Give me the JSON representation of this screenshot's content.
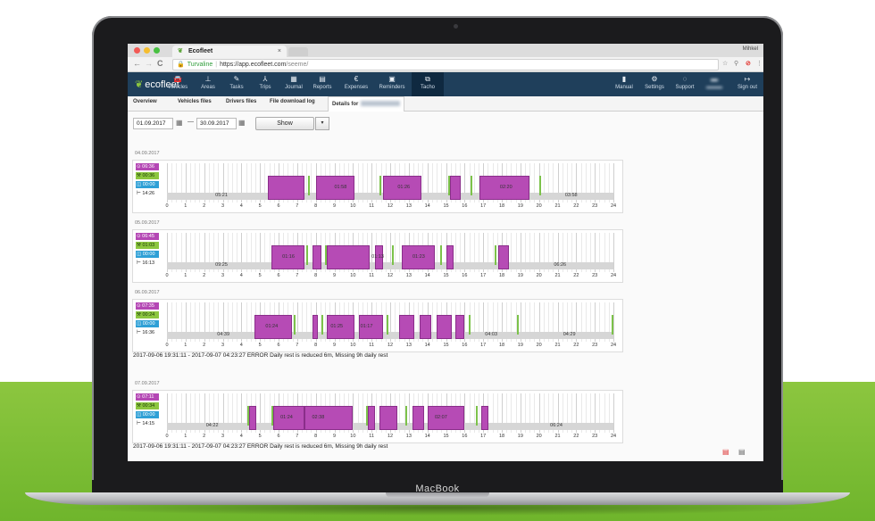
{
  "device": {
    "brand": "MacBook"
  },
  "browser": {
    "tab_title": "Ecofleet",
    "tab_close": "×",
    "user_name": "Mihkel",
    "url_org": "Turvaline",
    "url_host": "https://app.ecofleet.com",
    "url_path": "/seeme/",
    "back": "←",
    "forward": "→",
    "reload": "C"
  },
  "app": {
    "logo": "ecofleet",
    "nav": [
      {
        "icon": "🚘",
        "label": "Vehicles"
      },
      {
        "icon": "⊥",
        "label": "Areas"
      },
      {
        "icon": "✎",
        "label": "Tasks"
      },
      {
        "icon": "⅄",
        "label": "Trips"
      },
      {
        "icon": "▦",
        "label": "Journal"
      },
      {
        "icon": "▤",
        "label": "Reports"
      },
      {
        "icon": "€",
        "label": "Expenses"
      },
      {
        "icon": "▣",
        "label": "Reminders"
      },
      {
        "icon": "⧉",
        "label": "Tacho"
      }
    ],
    "right_nav": [
      {
        "icon": "▮",
        "label": "Manual"
      },
      {
        "icon": "⚙",
        "label": "Settings"
      },
      {
        "icon": "◌",
        "label": "Support"
      },
      {
        "icon": "↦",
        "label": "Sign out"
      }
    ],
    "subtabs": [
      "Overview",
      "Vehicles files",
      "Drivers files",
      "File download log",
      "Details for"
    ],
    "filter": {
      "from": "01.09.2017",
      "to": "30.09.2017",
      "separator": "—",
      "show_label": "Show",
      "caret": "▾"
    }
  },
  "days": [
    {
      "date": "04.09.2017",
      "totals": {
        "driving": "06:36",
        "work": "00:36",
        "available": "00:00",
        "rest": "14:26"
      },
      "rest_labels": [
        {
          "h": 2.6,
          "text": "05:21"
        },
        {
          "h": 21.4,
          "text": "03:58"
        }
      ],
      "drive_segments": [
        [
          5.4,
          7.4
        ],
        [
          8.0,
          10.1
        ],
        [
          11.6,
          13.7
        ],
        [
          15.2,
          15.8
        ],
        [
          16.8,
          19.5
        ]
      ],
      "drive_labels": [
        {
          "h": 9.0,
          "text": "01:58"
        },
        {
          "h": 12.4,
          "text": "01:26"
        },
        {
          "h": 17.9,
          "text": "02:20"
        }
      ],
      "work_ticks": [
        5.5,
        7.6,
        11.4,
        13.6,
        15.1,
        16.3,
        20.0
      ],
      "error": ""
    },
    {
      "date": "05.09.2017",
      "totals": {
        "driving": "06:45",
        "work": "01:03",
        "available": "00:00",
        "rest": "16:13"
      },
      "rest_labels": [
        {
          "h": 2.6,
          "text": "09:25"
        },
        {
          "h": 20.8,
          "text": "06:26"
        }
      ],
      "drive_segments": [
        [
          5.6,
          7.4
        ],
        [
          7.8,
          8.3
        ],
        [
          8.6,
          10.9
        ],
        [
          11.2,
          11.6
        ],
        [
          12.6,
          14.4
        ],
        [
          15.0,
          15.4
        ],
        [
          17.8,
          18.4
        ]
      ],
      "drive_labels": [
        {
          "h": 6.2,
          "text": "01:16"
        },
        {
          "h": 11.0,
          "text": "01:13"
        },
        {
          "h": 13.2,
          "text": "01:23"
        }
      ],
      "work_ticks": [
        6.9,
        7.5,
        8.5,
        9.8,
        10.8,
        12.1,
        14.7,
        17.6
      ],
      "error": ""
    },
    {
      "date": "06.09.2017",
      "totals": {
        "driving": "07:35",
        "work": "00:24",
        "available": "00:00",
        "rest": "16:36"
      },
      "rest_labels": [
        {
          "h": 2.7,
          "text": "04:39"
        },
        {
          "h": 17.1,
          "text": "04:03"
        },
        {
          "h": 21.3,
          "text": "04:29"
        }
      ],
      "drive_segments": [
        [
          4.7,
          6.7
        ],
        [
          7.8,
          8.1
        ],
        [
          8.6,
          10.1
        ],
        [
          10.3,
          11.6
        ],
        [
          12.5,
          13.3
        ],
        [
          13.6,
          14.2
        ],
        [
          14.5,
          15.3
        ],
        [
          15.5,
          16.0
        ]
      ],
      "drive_labels": [
        {
          "h": 5.3,
          "text": "01:24"
        },
        {
          "h": 8.8,
          "text": "01:25"
        },
        {
          "h": 10.4,
          "text": "01:17"
        }
      ],
      "work_ticks": [
        6.8,
        8.3,
        11.8,
        16.2,
        18.8,
        23.9
      ],
      "error": "2017-09-06 19:31:11 - 2017-09-07 04:23:27 ERROR Daily rest is reduced 6m, Missing 9h daily rest"
    },
    {
      "date": "07.09.2017",
      "totals": {
        "driving": "07:11",
        "work": "00:34",
        "available": "00:00",
        "rest": "14:15"
      },
      "rest_labels": [
        {
          "h": 2.1,
          "text": "04:22"
        },
        {
          "h": 20.6,
          "text": "06:24"
        }
      ],
      "drive_segments": [
        [
          4.4,
          4.8
        ],
        [
          5.7,
          7.4
        ],
        [
          7.4,
          10.0
        ],
        [
          10.8,
          11.2
        ],
        [
          11.4,
          12.4
        ],
        [
          13.2,
          13.8
        ],
        [
          14.0,
          16.0
        ],
        [
          16.9,
          17.3
        ]
      ],
      "drive_labels": [
        {
          "h": 6.1,
          "text": "01:24"
        },
        {
          "h": 7.8,
          "text": "02:38"
        },
        {
          "h": 14.4,
          "text": "02:07"
        }
      ],
      "work_ticks": [
        4.3,
        5.6,
        10.7,
        12.8,
        16.6
      ],
      "error": "2017-09-06 19:31:11 - 2017-09-07 04:23:27 ERROR Daily rest is reduced 6m, Missing 9h daily rest"
    }
  ],
  "hours": [
    "0",
    "1",
    "2",
    "3",
    "4",
    "5",
    "6",
    "7",
    "8",
    "9",
    "10",
    "11",
    "12",
    "13",
    "14",
    "15",
    "16",
    "17",
    "18",
    "19",
    "20",
    "21",
    "22",
    "23",
    "24"
  ],
  "colors": {
    "driving": "#b64bb5",
    "work": "#8cc63f",
    "available": "#2fa0d6",
    "rest": "#d6d6d6",
    "header": "#1f3f5b",
    "accent_green": "#8cc63f"
  },
  "icons": {
    "driving": "⊙",
    "work": "⚒",
    "available": "◫",
    "rest": "⊢",
    "pdf": "PDF",
    "doc": "DOC"
  }
}
